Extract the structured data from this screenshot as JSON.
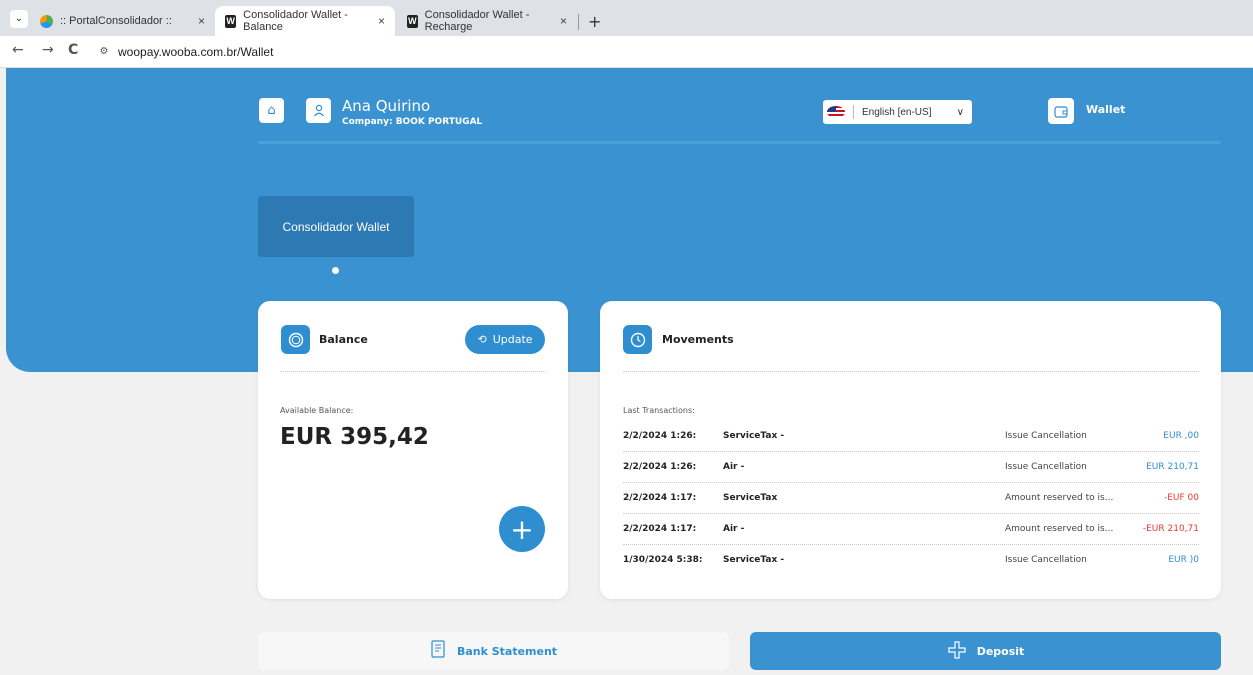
{
  "browser": {
    "tabs": [
      {
        "label": ":: PortalConsolidador ::",
        "close": "×"
      },
      {
        "label": "Consolidador Wallet - Balance",
        "close": "×"
      },
      {
        "label": "Consolidador Wallet - Recharge",
        "close": "×"
      }
    ],
    "new_tab": "+",
    "url": "woopay.wooba.com.br/Wallet"
  },
  "header": {
    "user_name": "Ana Quirino",
    "company": "Company: BOOK PORTUGAL",
    "language": "English [en-US]",
    "wallet_label": "Wallet"
  },
  "wallets": {
    "card_label": "Consolidador Wallet"
  },
  "balance": {
    "title": "Balance",
    "update_label": "Update",
    "available_label": "Available Balance:",
    "amount": "EUR 395,42",
    "add_label": "+"
  },
  "movements": {
    "title": "Movements",
    "last_label": "Last Transactions:",
    "rows": [
      {
        "date": "2/2/2024 1:26:",
        "desc": "ServiceTax -",
        "status": "Issue Cancellation",
        "value": "EUR ,00",
        "negative": false
      },
      {
        "date": "2/2/2024 1:26:",
        "desc": "Air -",
        "status": "Issue Cancellation",
        "value": "EUR 210,71",
        "negative": false
      },
      {
        "date": "2/2/2024 1:17:",
        "desc": "ServiceTax",
        "status": "Amount reserved to is...",
        "value": "-EUF 00",
        "negative": true
      },
      {
        "date": "2/2/2024 1:17:",
        "desc": "Air -",
        "status": "Amount reserved to is...",
        "value": "-EUR 210,71",
        "negative": true
      },
      {
        "date": "1/30/2024 5:38:",
        "desc": "ServiceTax -",
        "status": "Issue Cancellation",
        "value": "EUR )0",
        "negative": false
      }
    ]
  },
  "actions": {
    "bank_statement": "Bank Statement",
    "deposit": "Deposit"
  },
  "colors": {
    "primary": "#3a93d0",
    "negative": "#e53935"
  }
}
